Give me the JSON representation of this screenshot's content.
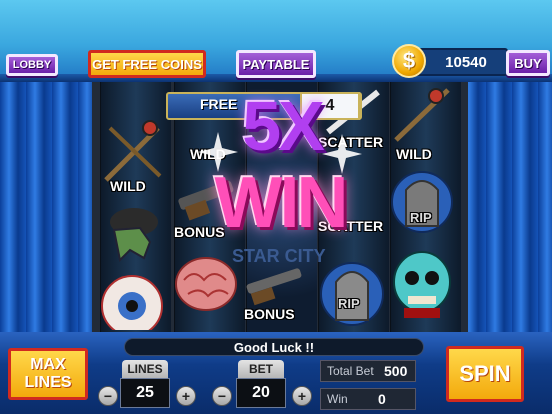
{
  "top_bar": {
    "lobby_label": "LOBBY",
    "free_coins_label": "GET FREE COINS",
    "paytable_label": "PAYTABLE",
    "coins_value": "10540",
    "coin_symbol": "$",
    "buy_label": "BUY"
  },
  "reels": {
    "free_spins_label": "FREE",
    "free_spins_count": "4",
    "symbols": {
      "reel1_wild": "WILD",
      "reel2_wild": "WILD",
      "reel2_bonus": "BONUS",
      "reel3_watermark": "STAR CITY",
      "reel3_bonus": "BONUS",
      "reel4_scatter_top": "SCATTER",
      "reel4_scatter_mid": "SCATTER",
      "reel4_rip": "RIP",
      "reel5_wild": "WILD",
      "reel5_rip": "RIP"
    }
  },
  "win_overlay": {
    "multiplier": "5X",
    "word": "WIN"
  },
  "bottom_bar": {
    "status": "Good Luck !!",
    "max_lines_label": "MAX LINES",
    "lines_label": "LINES",
    "lines_value": "25",
    "bet_label": "BET",
    "bet_value": "20",
    "total_bet_label": "Total Bet",
    "total_bet_value": "500",
    "win_label": "Win",
    "win_value": "0",
    "spin_label": "SPIN",
    "minus": "−",
    "plus": "+"
  },
  "colors": {
    "accent_purple": "#7a2fc0",
    "accent_yellow": "#f5b41a",
    "win_pink": "#ff4fb8",
    "win_purple": "#b13ff0"
  }
}
